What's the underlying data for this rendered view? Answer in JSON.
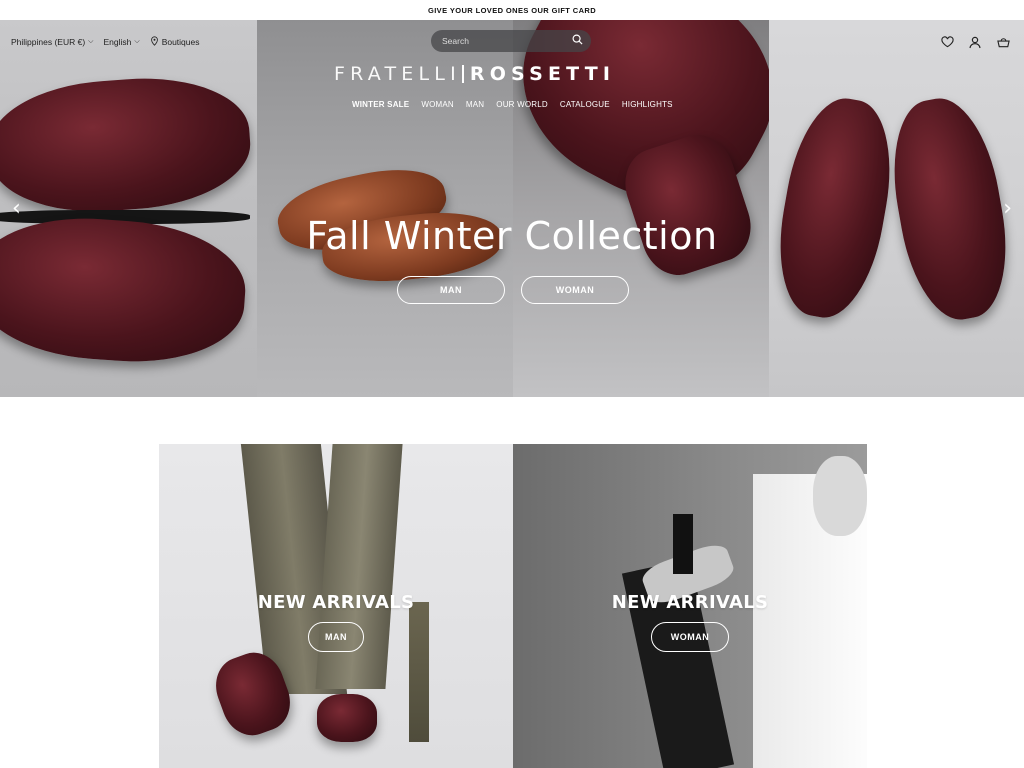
{
  "announcement": "GIVE YOUR LOVED ONES OUR GIFT CARD",
  "header": {
    "region": "Philippines (EUR €)",
    "language": "English",
    "boutiques": "Boutiques",
    "search_placeholder": "Search",
    "logo_left": "FRATELLI",
    "logo_right": "ROSSETTI",
    "nav": [
      {
        "label": "WINTER SALE",
        "active": true
      },
      {
        "label": "WOMAN"
      },
      {
        "label": "MAN"
      },
      {
        "label": "OUR WORLD"
      },
      {
        "label": "CATALOGUE"
      },
      {
        "label": "HIGHLIGHTS"
      }
    ],
    "icons": [
      "heart-icon",
      "user-icon",
      "bag-icon"
    ]
  },
  "hero": {
    "title": "Fall Winter Collection",
    "buttons": [
      "MAN",
      "WOMAN"
    ]
  },
  "tiles": [
    {
      "title": "NEW ARRIVALS",
      "button": "MAN"
    },
    {
      "title": "NEW ARRIVALS",
      "button": "WOMAN"
    }
  ],
  "colors": {
    "shoe_burgundy": "#5a1a24",
    "shoe_tan": "#8a4526",
    "white": "#ffffff"
  }
}
